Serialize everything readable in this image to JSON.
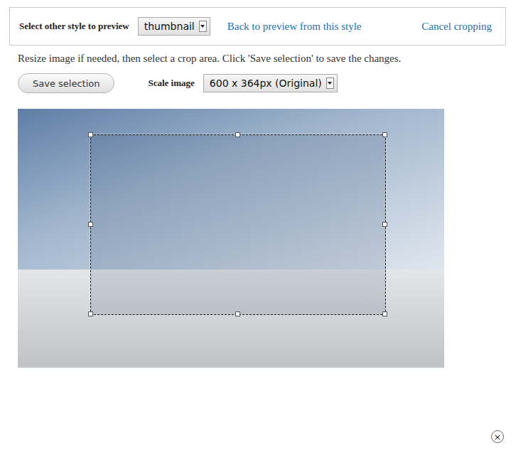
{
  "style_bar": {
    "label": "Select other style to preview",
    "style_select": {
      "value": "thumbnail"
    },
    "back_link": "Back to preview from this style",
    "cancel_link": "Cancel cropping"
  },
  "instructions": "Resize image if needed, then select a crop area. Click 'Save selection' to save the changes.",
  "save_button": "Save selection",
  "scale": {
    "label": "Scale image",
    "value": "600 x 364px (Original)"
  },
  "crop": {
    "handles": 8
  },
  "close_button": "×"
}
